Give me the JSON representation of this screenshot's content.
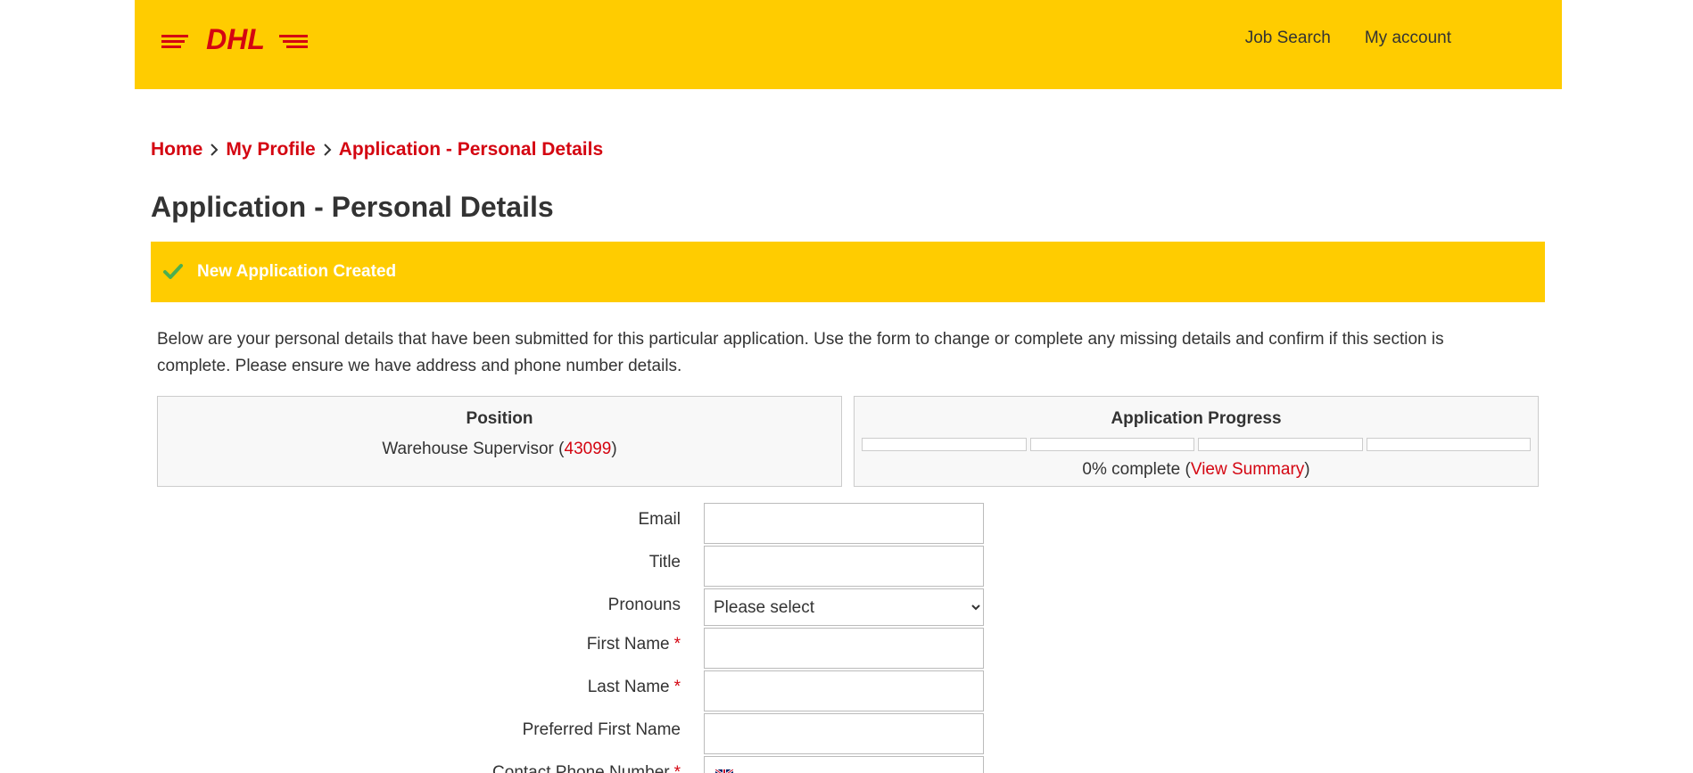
{
  "header": {
    "logo_text": "DHL",
    "nav": {
      "job_search": "Job Search",
      "my_account": "My account"
    },
    "colors": {
      "brand_yellow": "#FFCC00",
      "brand_red": "#D40511"
    }
  },
  "breadcrumb": {
    "items": [
      "Home",
      "My Profile",
      "Application - Personal Details"
    ],
    "separator_icon": "chevron-right-icon"
  },
  "page": {
    "title": "Application - Personal Details"
  },
  "alert": {
    "icon": "check-icon",
    "text": "New Application Created"
  },
  "intro": {
    "text": "Below are your personal details that have been submitted for this particular application. Use the form to change or complete any missing details and confirm if this section is complete. Please ensure we have address and phone number details."
  },
  "position_box": {
    "title": "Position",
    "job_title": "Warehouse Supervisor",
    "job_id": "43099"
  },
  "progress_box": {
    "title": "Application Progress",
    "segments_completed": 0,
    "segments_total": 4,
    "percent_text": "0% complete",
    "summary_link": "View Summary"
  },
  "form": {
    "fields": [
      {
        "label": "Email",
        "required": false,
        "value": "",
        "type": "text"
      },
      {
        "label": "Title",
        "required": false,
        "value": "",
        "type": "text"
      },
      {
        "label": "Pronouns",
        "required": false,
        "value": "Please select",
        "type": "select"
      },
      {
        "label": "First Name",
        "required": true,
        "value": "",
        "type": "text"
      },
      {
        "label": "Last Name",
        "required": true,
        "value": "",
        "type": "text"
      },
      {
        "label": "Preferred First Name",
        "required": false,
        "value": "",
        "type": "text"
      },
      {
        "label": "Contact Phone Number",
        "required": true,
        "value": "",
        "type": "phone"
      }
    ],
    "required_marker": "*",
    "phone_flag_icon": "uk-flag-icon"
  }
}
